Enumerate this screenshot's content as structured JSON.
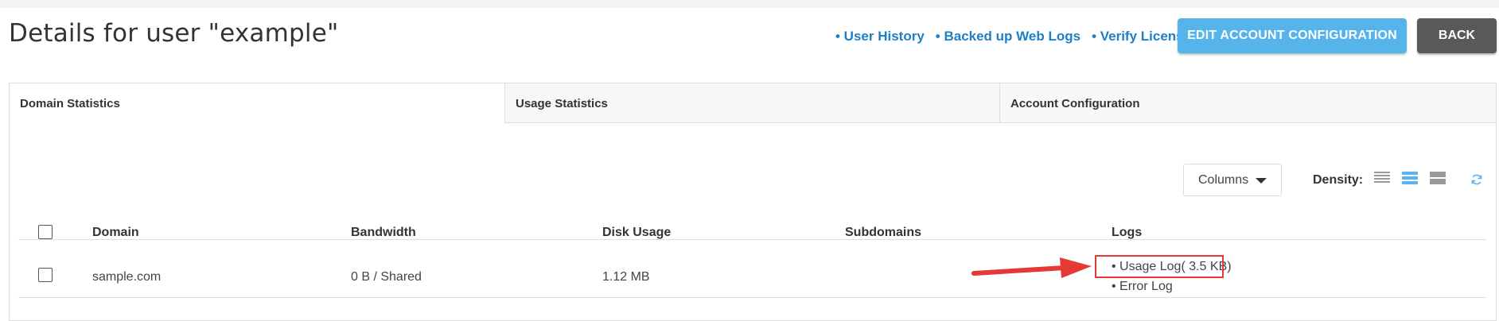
{
  "page": {
    "title": "Details for user \"example\""
  },
  "header": {
    "links": [
      "• User History",
      "• Backed up Web Logs",
      "• Verify License"
    ],
    "edit_button": "EDIT ACCOUNT CONFIGURATION",
    "back_button": "BACK"
  },
  "tabs": [
    "Domain Statistics",
    "Usage Statistics",
    "Account Configuration"
  ],
  "toolbar": {
    "columns_label": "Columns",
    "density_label": "Density:"
  },
  "table": {
    "headers": [
      "Domain",
      "Bandwidth",
      "Disk Usage",
      "Subdomains",
      "Logs"
    ],
    "rows": [
      {
        "domain": "sample.com",
        "bandwidth": "0 B / Shared",
        "disk_usage": "1.12 MB",
        "subdomains": "",
        "logs": [
          "• Usage Log( 3.5 KB)",
          "• Error Log"
        ]
      }
    ]
  },
  "colors": {
    "accent": "#56b4ec",
    "link": "#1e7fc7",
    "back": "#595959",
    "annotation": "#e53935"
  },
  "icons": [
    "chevron-down-icon",
    "density-compact-icon",
    "density-standard-icon",
    "density-comfortable-icon",
    "refresh-icon",
    "annotation-arrow-icon"
  ]
}
